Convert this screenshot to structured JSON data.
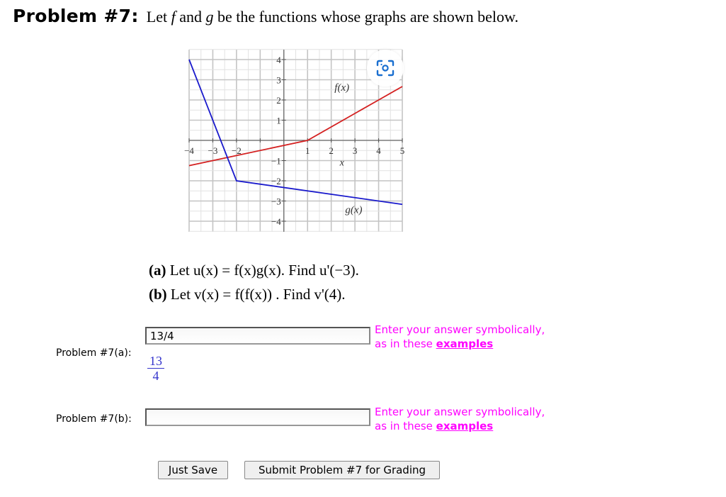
{
  "header": {
    "problem_label": "Problem #7:",
    "intro_prefix": "Let ",
    "f_symbol": "f",
    "intro_mid": " and ",
    "g_symbol": "g",
    "intro_suffix": " be the functions whose graphs are shown below."
  },
  "graph": {
    "x_ticks": [
      "−4",
      "−3",
      "−2",
      "1",
      "2",
      "3",
      "4",
      "5"
    ],
    "y_ticks": [
      "4",
      "3",
      "2",
      "1",
      "−1",
      "−2",
      "−3",
      "−4"
    ],
    "x_axis_label": "x",
    "f_label": "f(x)",
    "g_label": "g(x)",
    "colors": {
      "f": "#d42020",
      "g": "#1a1acc",
      "grid": "#cfcfcf"
    },
    "scan_icon": "visual-search-icon"
  },
  "chart_data": {
    "type": "line",
    "xlabel": "x",
    "ylabel": "",
    "xlim": [
      -4,
      5
    ],
    "ylim": [
      -4.5,
      4.5
    ],
    "grid": true,
    "series": [
      {
        "name": "f(x)",
        "x": [
          -4,
          1,
          4,
          5
        ],
        "y": [
          -1.25,
          0,
          2,
          2.667
        ]
      },
      {
        "name": "g(x)",
        "x": [
          -4,
          -2,
          5
        ],
        "y": [
          4,
          -2,
          -3.167
        ]
      }
    ],
    "annotations": [
      "f(x)",
      "g(x)"
    ]
  },
  "questions": {
    "a_label": "(a)",
    "a_text": " Let  u(x) = f(x)g(x).  Find u'(−3).",
    "b_label": "(b)",
    "b_text": " Let  v(x) = f(f(x)) .  Find v'(4)."
  },
  "answers": {
    "a": {
      "label": "Problem #7(a):",
      "value": "13/4",
      "preview_num": "13",
      "preview_den": "4"
    },
    "b": {
      "label": "Problem #7(b):",
      "value": ""
    }
  },
  "hint": {
    "line1": "Enter your answer symbolically,",
    "line2_prefix": "as in these ",
    "link": "examples"
  },
  "buttons": {
    "save": "Just Save",
    "submit": "Submit Problem #7 for Grading"
  }
}
